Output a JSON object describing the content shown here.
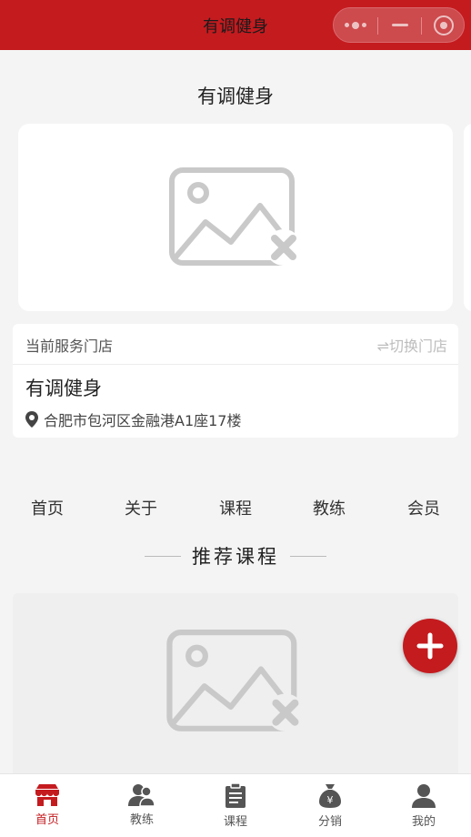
{
  "header": {
    "title": "有调健身",
    "capsule": {
      "more_icon": "more-dots-icon",
      "minimize_icon": "minimize-icon",
      "close_icon": "target-icon"
    }
  },
  "page_title": "有调健身",
  "banner": {
    "image_icon": "broken-image-icon"
  },
  "store": {
    "label": "当前服务门店",
    "switch_label": "⇌切换门店",
    "name": "有调健身",
    "address": "合肥市包河区金融港A1座17楼"
  },
  "nav": [
    {
      "label": "首页"
    },
    {
      "label": "关于"
    },
    {
      "label": "课程"
    },
    {
      "label": "教练"
    },
    {
      "label": "会员"
    }
  ],
  "section": {
    "title": "推荐课程"
  },
  "fab": {
    "icon": "plus-icon"
  },
  "tabbar": [
    {
      "label": "首页",
      "icon": "store-icon",
      "active": true
    },
    {
      "label": "教练",
      "icon": "coach-icon",
      "active": false
    },
    {
      "label": "课程",
      "icon": "clipboard-icon",
      "active": false
    },
    {
      "label": "分销",
      "icon": "money-bag-icon",
      "active": false
    },
    {
      "label": "我的",
      "icon": "user-icon",
      "active": false
    }
  ],
  "colors": {
    "primary": "#c41b1f",
    "background": "#f4f4f4",
    "card": "#ffffff",
    "muted": "#bdbdbd"
  }
}
